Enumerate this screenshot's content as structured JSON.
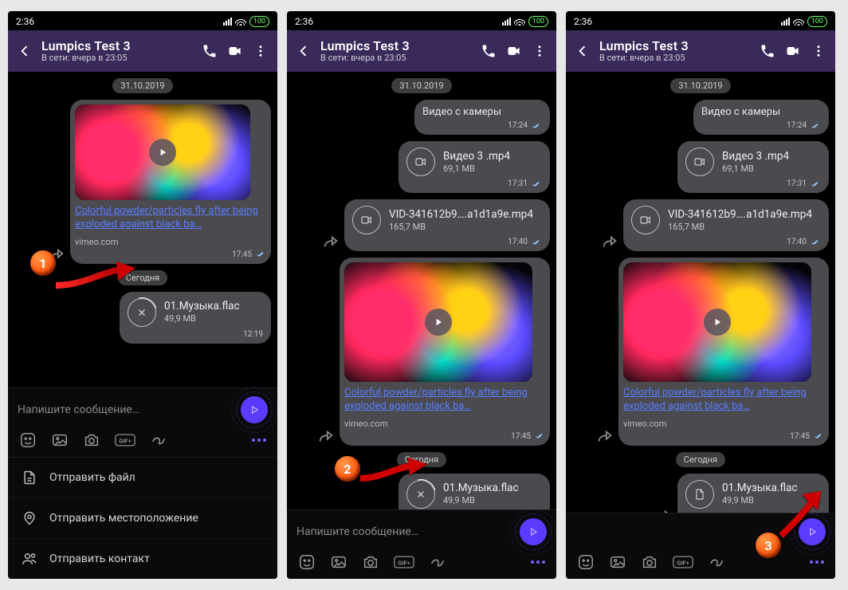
{
  "status": {
    "time": "2:36",
    "battery": "100"
  },
  "header": {
    "name": "Lumpics Test 3",
    "sub": "В сети: вчера в 23:05"
  },
  "dates": {
    "old": "31.10.2019",
    "today": "Сегодня"
  },
  "camera_msg": {
    "text": "Видео с камеры",
    "time": "17:24"
  },
  "video3": {
    "name": "Видео 3 .mp4",
    "size": "69,1 MB",
    "time": "17:31"
  },
  "vid341": {
    "name": "VID-341612b9….a1d1a9e.mp4",
    "size": "165,7 MB",
    "time": "17:40"
  },
  "link": {
    "title": "Colorful powder/particles fly after being exploded against black ba…",
    "domain": "vimeo.com",
    "time": "17:45"
  },
  "music": {
    "name": "01.Музыка.flac",
    "size": "49,9 MB",
    "time": "12:19"
  },
  "compose": {
    "placeholder": "Напишите сообщение…"
  },
  "attach": {
    "file": "Отправить файл",
    "location": "Отправить местоположение",
    "contact": "Отправить контакт"
  },
  "badges": {
    "b1": "1",
    "b2": "2",
    "b3": "3"
  }
}
